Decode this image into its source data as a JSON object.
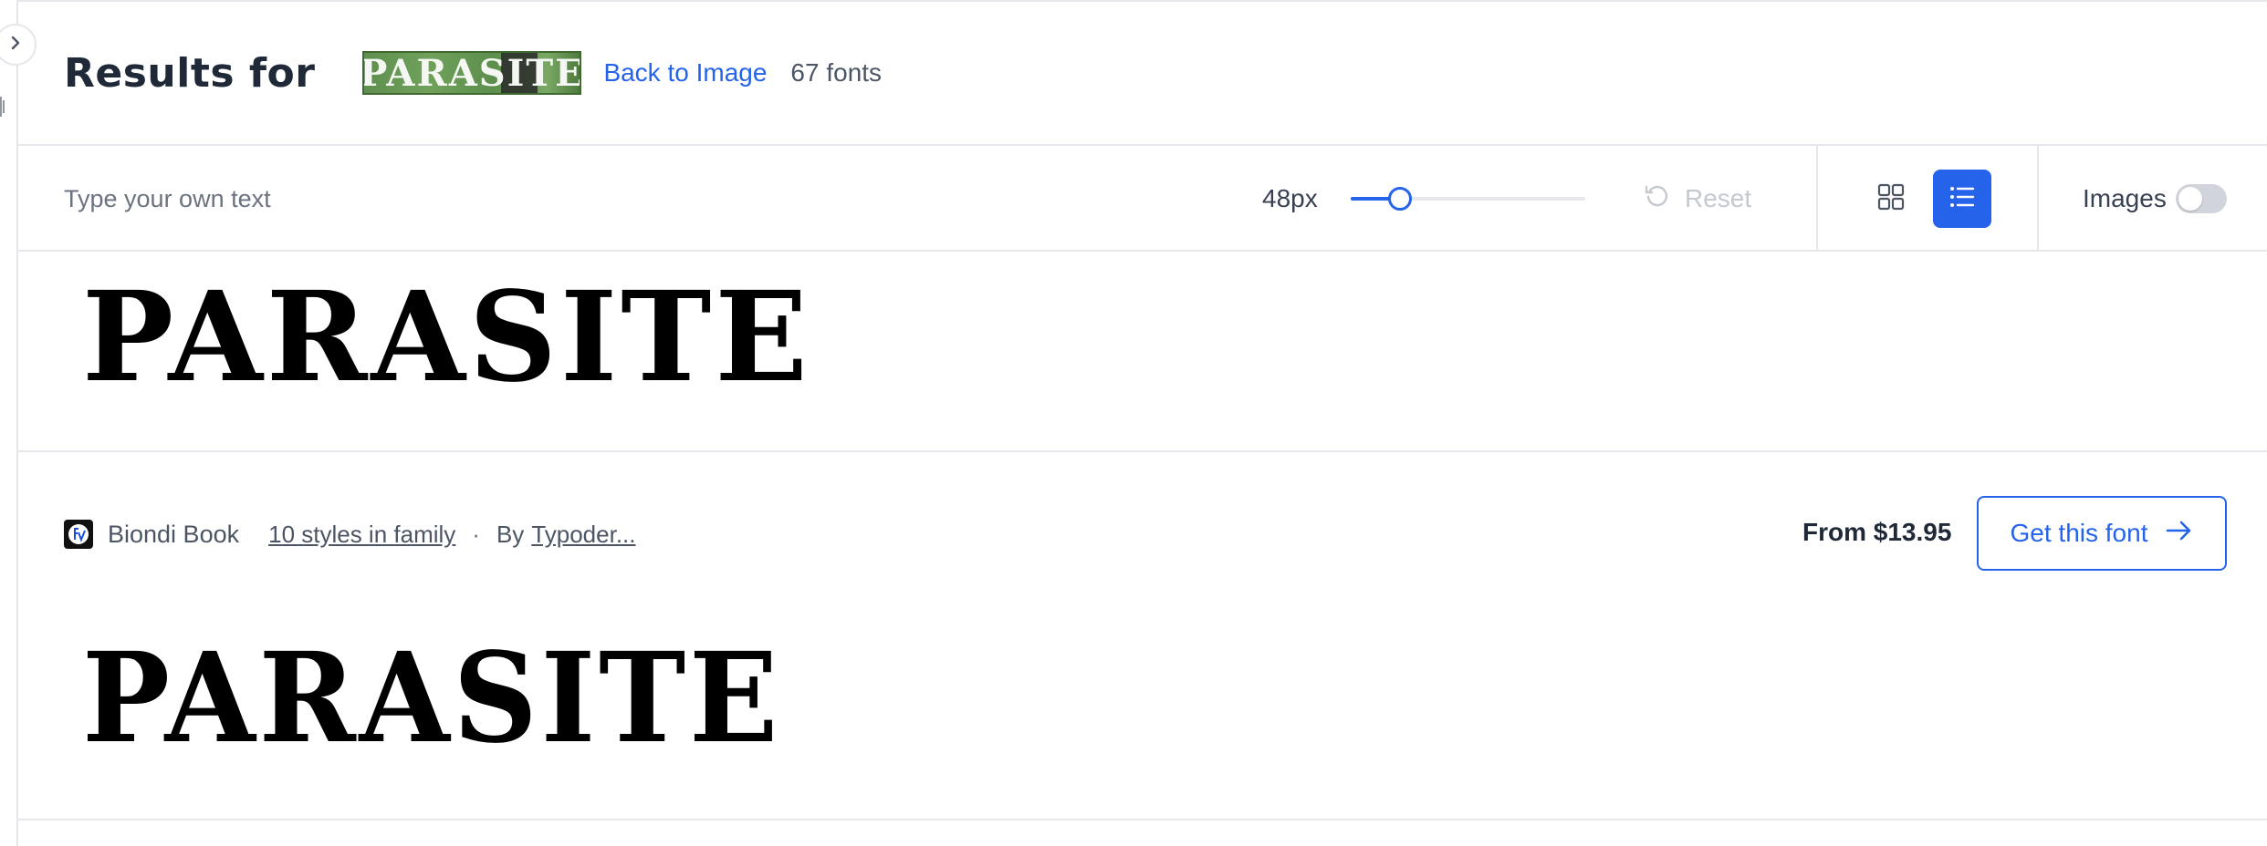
{
  "header": {
    "title": "Results for",
    "thumbnail_text": "PARASITE",
    "back_link": "Back to Image",
    "font_count": "67 fonts"
  },
  "toolbar": {
    "custom_text_placeholder": "Type your own text",
    "size_label": "48px",
    "size_slider_fraction": 0.21,
    "reset_label": "Reset",
    "images_label": "Images",
    "images_enabled": false,
    "active_view": "list"
  },
  "previews": [
    {
      "text": "PARASITE"
    },
    {
      "text": "PARASITE"
    }
  ],
  "card": {
    "font_name": "Biondi Book",
    "styles_link": "10 styles in family",
    "separator": "·",
    "by_label": "By",
    "designer": "Typoder...",
    "price": "From $13.95",
    "cta": "Get this font"
  },
  "colors": {
    "accent": "#2563eb",
    "border": "#e5e7eb",
    "muted_text": "#6b7280"
  }
}
